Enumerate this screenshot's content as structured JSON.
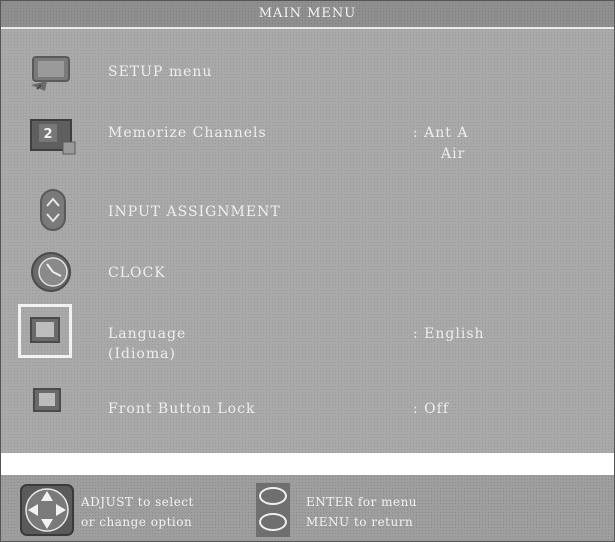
{
  "title": "MAIN MENU",
  "menu": {
    "items": [
      {
        "label": "SETUP menu",
        "icon": "setup-monitor-icon"
      },
      {
        "label": "Memorize Channels",
        "value": ": Ant A",
        "value2": "Air",
        "icon": "channel-2-icon",
        "icon_text": "2"
      },
      {
        "label": "INPUT ASSIGNMENT",
        "icon": "input-assignment-icon"
      },
      {
        "label": "CLOCK",
        "icon": "clock-icon"
      },
      {
        "label": "Language",
        "sublabel": "(Idioma)",
        "value": ": English",
        "icon": "language-icon"
      },
      {
        "label": "Front Button Lock",
        "value": ": Off",
        "icon": "lock-icon"
      }
    ],
    "selected_index": 4
  },
  "footer": {
    "adjust_line1": "ADJUST to select",
    "adjust_line2": "or change option",
    "enter_text": "ENTER for menu",
    "menu_text": "MENU  to return"
  },
  "colors": {
    "background": "#a9a9a9",
    "title_bar": "#8f8f8f",
    "text": "#eeeeee",
    "highlight": "#f2f2f2"
  }
}
